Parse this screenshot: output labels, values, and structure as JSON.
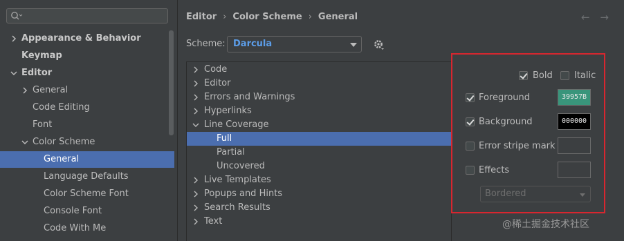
{
  "search": {
    "placeholder": ""
  },
  "sidebar": {
    "items": [
      {
        "label": "Appearance & Behavior",
        "chevron": "right"
      },
      {
        "label": "Keymap",
        "chevron": ""
      },
      {
        "label": "Editor",
        "chevron": "down"
      },
      {
        "label": "General",
        "chevron": "right"
      },
      {
        "label": "Code Editing",
        "chevron": ""
      },
      {
        "label": "Font",
        "chevron": ""
      },
      {
        "label": "Color Scheme",
        "chevron": "down"
      },
      {
        "label": "General",
        "chevron": "",
        "selected": true
      },
      {
        "label": "Language Defaults",
        "chevron": ""
      },
      {
        "label": "Color Scheme Font",
        "chevron": ""
      },
      {
        "label": "Console Font",
        "chevron": ""
      },
      {
        "label": "Code With Me",
        "chevron": ""
      }
    ]
  },
  "breadcrumb": {
    "items": [
      "Editor",
      "Color Scheme",
      "General"
    ],
    "separator": "›"
  },
  "nav": {
    "back": "←",
    "forward": "→"
  },
  "scheme": {
    "label": "Scheme:",
    "value": "Darcula"
  },
  "tree": {
    "items": [
      {
        "label": "Code",
        "chevron": "right"
      },
      {
        "label": "Editor",
        "chevron": "right"
      },
      {
        "label": "Errors and Warnings",
        "chevron": "right"
      },
      {
        "label": "Hyperlinks",
        "chevron": "right"
      },
      {
        "label": "Line Coverage",
        "chevron": "down"
      },
      {
        "label": "Full",
        "chevron": "",
        "selected": true
      },
      {
        "label": "Partial",
        "chevron": ""
      },
      {
        "label": "Uncovered",
        "chevron": ""
      },
      {
        "label": "Live Templates",
        "chevron": "right"
      },
      {
        "label": "Popups and Hints",
        "chevron": "right"
      },
      {
        "label": "Search Results",
        "chevron": "right"
      },
      {
        "label": "Text",
        "chevron": "right"
      }
    ]
  },
  "props": {
    "bold": {
      "label": "Bold",
      "checked": true
    },
    "italic": {
      "label": "Italic",
      "checked": false
    },
    "foreground": {
      "label": "Foreground",
      "checked": true,
      "value": "39957B",
      "color": "#39957b"
    },
    "background": {
      "label": "Background",
      "checked": true,
      "value": "000000",
      "color": "#000000"
    },
    "error_stripe": {
      "label": "Error stripe mark",
      "checked": false
    },
    "effects": {
      "label": "Effects",
      "checked": false
    },
    "effect_type": "Bordered"
  },
  "watermark": "@稀土掘金技术社区",
  "colors": {
    "selection": "#4b6eaf",
    "accent_text": "#5c9de8",
    "highlight_box": "#d8262f"
  }
}
